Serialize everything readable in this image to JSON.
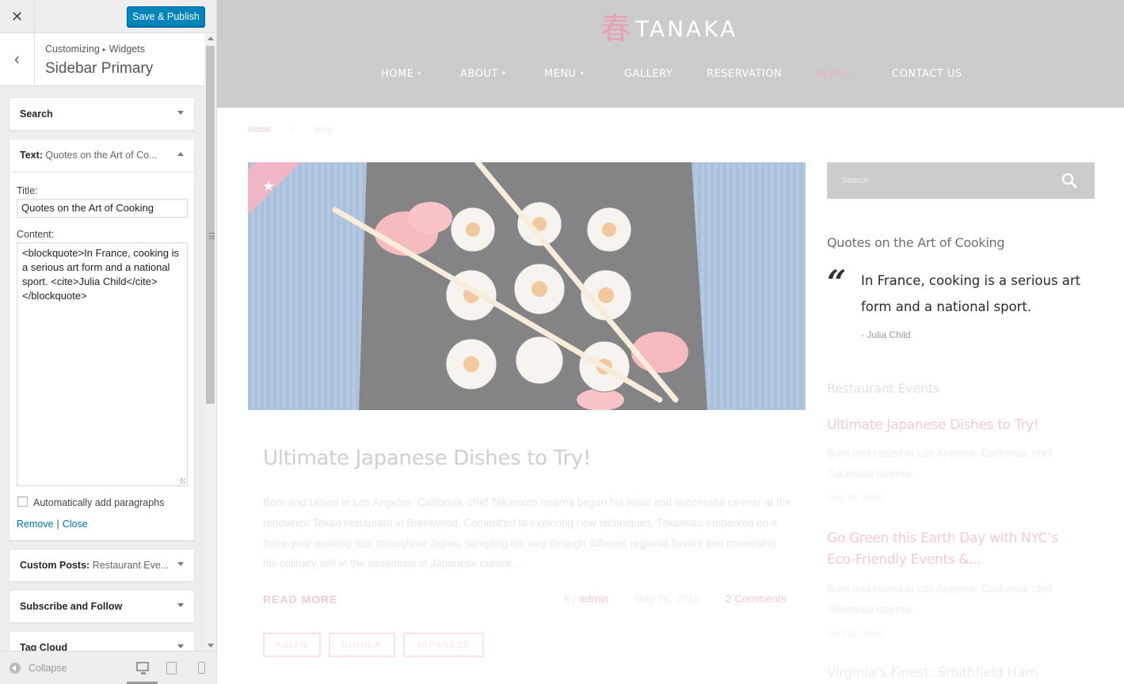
{
  "customizer": {
    "close_icon": "close-icon",
    "save_label": "Save & Publish",
    "breadcrumb": {
      "root": "Customizing",
      "separator": "▸",
      "section": "Widgets"
    },
    "section_title": "Sidebar Primary",
    "widgets": [
      {
        "type": "Search",
        "sub": "",
        "state": "collapsed"
      },
      {
        "type": "Text:",
        "sub": "Quotes on the Art of Co...",
        "state": "expanded"
      },
      {
        "type": "Custom Posts:",
        "sub": "Restaurant Eve...",
        "state": "collapsed"
      },
      {
        "type": "Subscribe and Follow",
        "sub": "",
        "state": "collapsed"
      },
      {
        "type": "Tag Cloud",
        "sub": "",
        "state": "collapsed"
      }
    ],
    "text_widget": {
      "title_label": "Title:",
      "title_value": "Quotes on the Art of Cooking",
      "content_label": "Content:",
      "content_value": "<blockquote>In France, cooking is a serious art form and a national sport. <cite>Julia Child</cite>\n</blockquote>",
      "auto_paragraphs_label": "Automatically add paragraphs",
      "auto_paragraphs_checked": false,
      "remove_label": "Remove",
      "pipe": "|",
      "close_label": "Close"
    },
    "footer": {
      "collapse_label": "Collapse",
      "devices": [
        "desktop-icon",
        "tablet-icon",
        "mobile-icon"
      ],
      "active_device": "desktop"
    }
  },
  "site": {
    "logo_mark": "春",
    "logo_text": "TANAKA",
    "nav": [
      {
        "label": "HOME",
        "dropdown": true,
        "active": false
      },
      {
        "label": "ABOUT",
        "dropdown": true,
        "active": false
      },
      {
        "label": "MENU",
        "dropdown": true,
        "active": false
      },
      {
        "label": "GALLERY",
        "dropdown": false,
        "active": false
      },
      {
        "label": "RESERVATION",
        "dropdown": false,
        "active": false
      },
      {
        "label": "BLOG",
        "dropdown": true,
        "active": true
      },
      {
        "label": "CONTACT US",
        "dropdown": false,
        "active": false
      }
    ],
    "breadcrumbs": {
      "home": "Home",
      "separator": "/",
      "current": "Blog"
    },
    "post": {
      "title": "Ultimate Japanese Dishes to Try!",
      "excerpt": "Born and raised in Los Angeles, California, chef Takamoto Isojima began his initial and successful ca-reer at the renowned Takao restaurant in Brentwood. Committed to exploring new techniques, Takamoto embarked on a three-year working tour throughout Japan, sampling his way through different regional flavors and immersing his culinary self in the essentials of Japanese cuisine...",
      "read_more": "READ MORE",
      "by": "By",
      "author": "admin",
      "date": "May 26, 2016",
      "comments": "2 Comments",
      "tags": [
        "ASIAN",
        "DINNER",
        "JAPANESE"
      ]
    },
    "sidebar": {
      "search_placeholder": "Search",
      "quote_heading": "Quotes on the Art of Cooking",
      "quote_mark": "“",
      "quote_text": "In France, cooking is a serious art form and a national sport.",
      "quote_cite": "- Julia Child",
      "events_heading": "Restaurant Events",
      "events": [
        {
          "title": "Ultimate Japanese Dishes to Try!",
          "excerpt": "Born and raised in Los Angeles, California, chef Takamoto Isojima...",
          "date": "May 26, 2016"
        },
        {
          "title": "Go Green this Earth Day with NYC’s Eco-Friendly Events &...",
          "excerpt": "Born and raised in Los Angeles, California, chef Takamoto Isojima...",
          "date": "April 12, 2016"
        },
        {
          "title": "Virginia’s Finest: Smithfield Ham",
          "excerpt": "",
          "date": ""
        }
      ]
    }
  },
  "colors": {
    "primary_button": "#0085ba",
    "link": "#0073aa",
    "brand_pink": "#e8a2b5",
    "header_gray": "#cccccc"
  }
}
